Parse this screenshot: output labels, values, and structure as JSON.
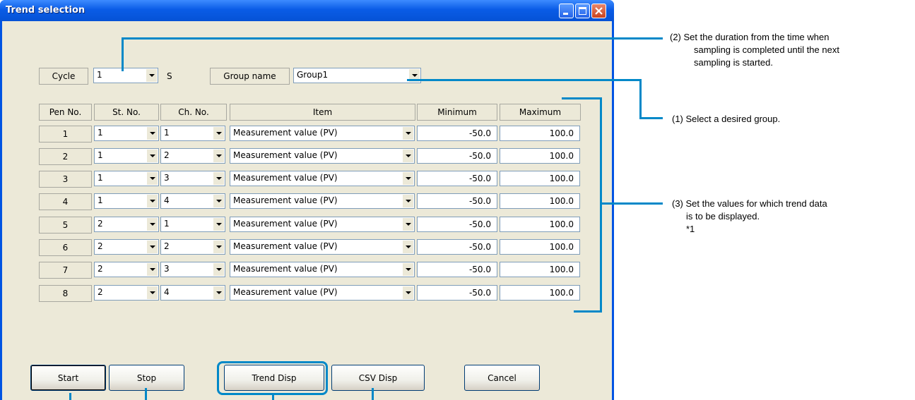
{
  "window": {
    "title": "Trend selection"
  },
  "cycle": {
    "label": "Cycle",
    "value": "1",
    "unit": "S"
  },
  "group": {
    "label": "Group name",
    "value": "Group1"
  },
  "columns": [
    "Pen No.",
    "St. No.",
    "Ch. No.",
    "Item",
    "Minimum",
    "Maximum"
  ],
  "rows": [
    {
      "pen": "1",
      "st": "1",
      "ch": "1",
      "item": "Measurement value (PV)",
      "min": "-50.0",
      "max": "100.0"
    },
    {
      "pen": "2",
      "st": "1",
      "ch": "2",
      "item": "Measurement value (PV)",
      "min": "-50.0",
      "max": "100.0"
    },
    {
      "pen": "3",
      "st": "1",
      "ch": "3",
      "item": "Measurement value (PV)",
      "min": "-50.0",
      "max": "100.0"
    },
    {
      "pen": "4",
      "st": "1",
      "ch": "4",
      "item": "Measurement value (PV)",
      "min": "-50.0",
      "max": "100.0"
    },
    {
      "pen": "5",
      "st": "2",
      "ch": "1",
      "item": "Measurement value (PV)",
      "min": "-50.0",
      "max": "100.0"
    },
    {
      "pen": "6",
      "st": "2",
      "ch": "2",
      "item": "Measurement value (PV)",
      "min": "-50.0",
      "max": "100.0"
    },
    {
      "pen": "7",
      "st": "2",
      "ch": "3",
      "item": "Measurement value (PV)",
      "min": "-50.0",
      "max": "100.0"
    },
    {
      "pen": "8",
      "st": "2",
      "ch": "4",
      "item": "Measurement value (PV)",
      "min": "-50.0",
      "max": "100.0"
    }
  ],
  "buttons": {
    "start": "Start",
    "stop": "Stop",
    "trend": "Trend Disp",
    "csv": "CSV Disp",
    "cancel": "Cancel"
  },
  "annotations": {
    "a2_line1": "(2) Set the duration from the time when",
    "a2_line2": "sampling is completed until the next",
    "a2_line3": "sampling is started.",
    "a1": "(1) Select a desired group.",
    "a3_line1": "(3) Set the values for which trend data",
    "a3_line2": "is to be displayed.",
    "a3_line3": "*1"
  },
  "colors": {
    "annotation": "#0088c8",
    "titlebar": "#0054e3"
  }
}
